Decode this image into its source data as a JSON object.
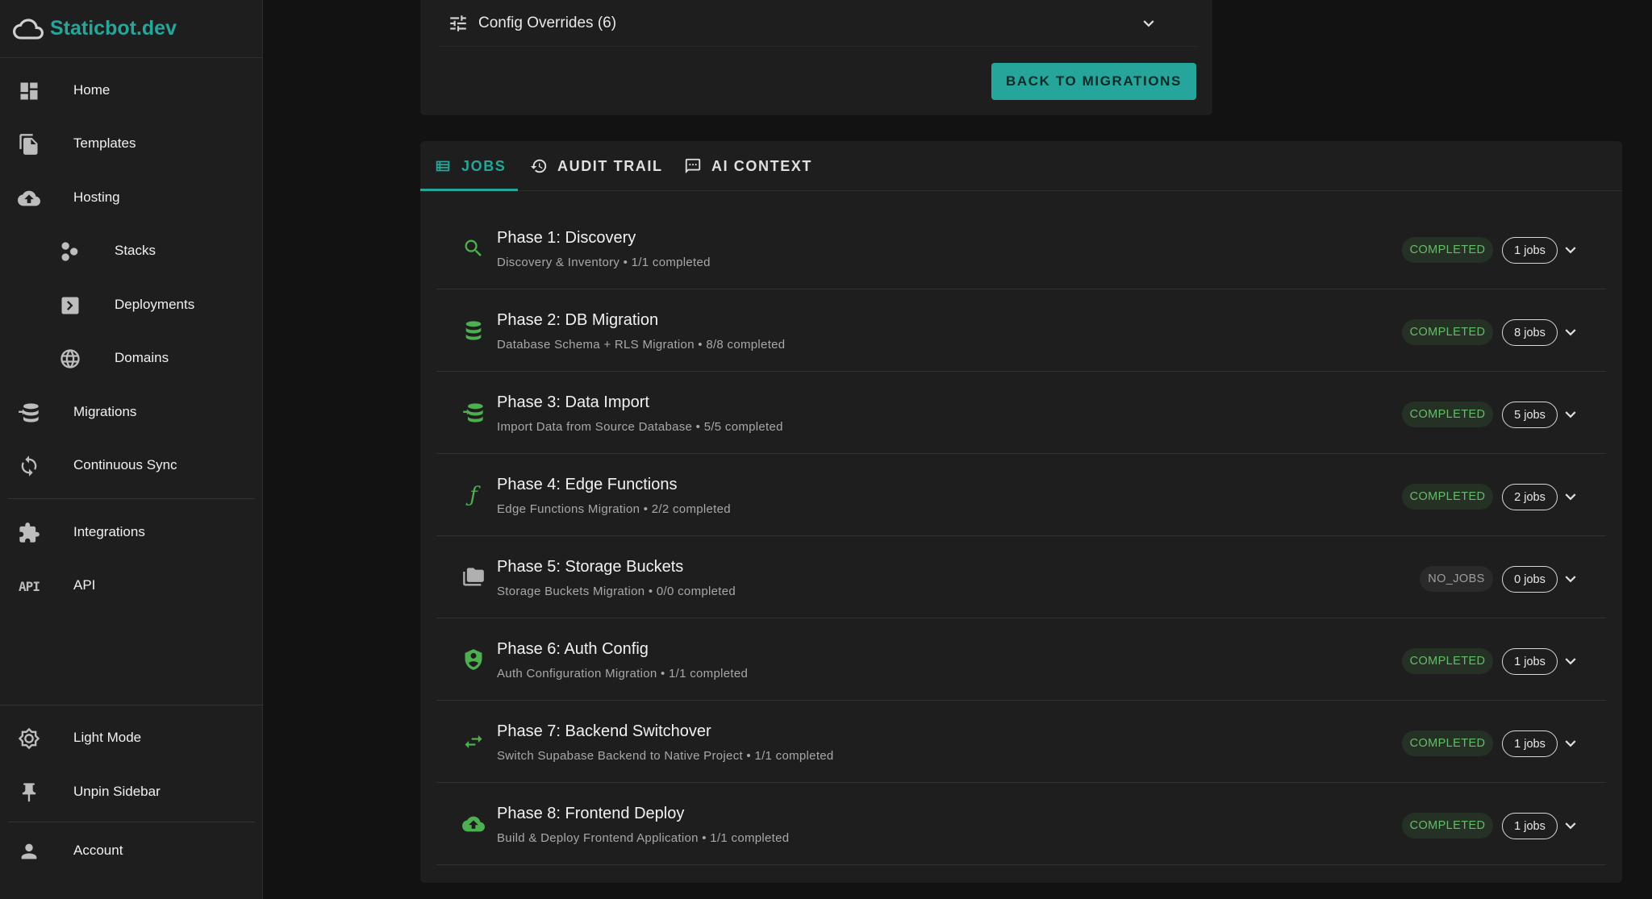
{
  "brand": {
    "name": "Staticbot.dev"
  },
  "sidebar": {
    "items": [
      {
        "label": "Home",
        "icon": "dashboard-icon"
      },
      {
        "label": "Templates",
        "icon": "documents-icon"
      },
      {
        "label": "Hosting",
        "icon": "cloud-upload-icon"
      },
      {
        "label": "Stacks",
        "icon": "hexagons-icon"
      },
      {
        "label": "Deployments",
        "icon": "chevron-box-icon"
      },
      {
        "label": "Domains",
        "icon": "globe-icon"
      },
      {
        "label": "Migrations",
        "icon": "database-arrow-icon"
      },
      {
        "label": "Continuous Sync",
        "icon": "sync-icon"
      },
      {
        "label": "Integrations",
        "icon": "puzzle-icon"
      },
      {
        "label": "API",
        "icon": "api-icon",
        "icon_text": "API"
      }
    ],
    "bottom": [
      {
        "label": "Light Mode",
        "icon": "brightness-icon"
      },
      {
        "label": "Unpin Sidebar",
        "icon": "pin-icon"
      },
      {
        "label": "Account",
        "icon": "person-icon"
      }
    ]
  },
  "top_card": {
    "overrides_label": "Config Overrides (6)",
    "back_button": "BACK TO MIGRATIONS"
  },
  "tabs": [
    {
      "label": "JOBS",
      "active": true,
      "icon": "list-icon"
    },
    {
      "label": "AUDIT TRAIL",
      "active": false,
      "icon": "history-icon"
    },
    {
      "label": "AI CONTEXT",
      "active": false,
      "icon": "ai-chat-icon"
    }
  ],
  "phases": [
    {
      "title": "Phase 1: Discovery",
      "subtitle": "Discovery & Inventory • 1/1 completed",
      "status": "COMPLETED",
      "jobs": "1 jobs",
      "icon": "search-icon"
    },
    {
      "title": "Phase 2: DB Migration",
      "subtitle": "Database Schema + RLS Migration • 8/8 completed",
      "status": "COMPLETED",
      "jobs": "8 jobs",
      "icon": "database-icon"
    },
    {
      "title": "Phase 3: Data Import",
      "subtitle": "Import Data from Source Database • 5/5 completed",
      "status": "COMPLETED",
      "jobs": "5 jobs",
      "icon": "database-import-icon"
    },
    {
      "title": "Phase 4: Edge Functions",
      "subtitle": "Edge Functions Migration • 2/2 completed",
      "status": "COMPLETED",
      "jobs": "2 jobs",
      "icon": "function-icon",
      "icon_text": "ƒ"
    },
    {
      "title": "Phase 5: Storage Buckets",
      "subtitle": "Storage Buckets Migration • 0/0 completed",
      "status": "NO_JOBS",
      "jobs": "0 jobs",
      "icon": "folders-icon"
    },
    {
      "title": "Phase 6: Auth Config",
      "subtitle": "Auth Configuration Migration • 1/1 completed",
      "status": "COMPLETED",
      "jobs": "1 jobs",
      "icon": "shield-person-icon"
    },
    {
      "title": "Phase 7: Backend Switchover",
      "subtitle": "Switch Supabase Backend to Native Project • 1/1 completed",
      "status": "COMPLETED",
      "jobs": "1 jobs",
      "icon": "swap-icon"
    },
    {
      "title": "Phase 8: Frontend Deploy",
      "subtitle": "Build & Deploy Frontend Application • 1/1 completed",
      "status": "COMPLETED",
      "jobs": "1 jobs",
      "icon": "cloud-upload-icon"
    }
  ],
  "colors": {
    "accent": "#26a69a",
    "success": "#4caf50",
    "background": "#121212",
    "surface": "#1e1e1e"
  }
}
